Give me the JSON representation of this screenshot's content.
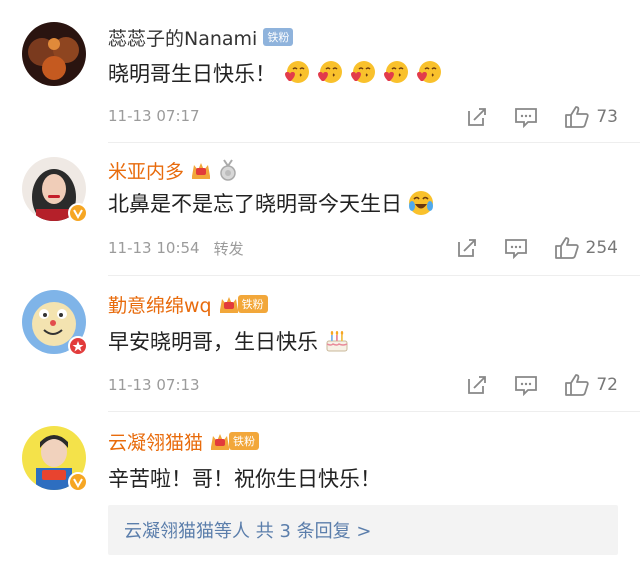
{
  "comments": [
    {
      "username": "蕊蕊子的Nanami",
      "badge": "铁粉",
      "text": "晓明哥生日快乐！",
      "emoji_count": 5,
      "emoji_icon": "kiss-heart-emoji",
      "time": "11-13 07:17",
      "likes": "73"
    },
    {
      "username": "米亚内多",
      "text": "北鼻是不是忘了晓明哥今天生日",
      "emoji_icon": "crying-laughing-emoji",
      "time": "11-13 10:54",
      "forward": "转发",
      "likes": "254"
    },
    {
      "username": "勤意绵绵wq",
      "badge": "铁粉",
      "text": "早安晓明哥，生日快乐",
      "emoji_icon": "birthday-cake-emoji",
      "time": "11-13 07:13",
      "likes": "72"
    },
    {
      "username": "云凝翎猫猫",
      "badge": "铁粉",
      "text": "辛苦啦！哥！祝你生日快乐！"
    }
  ],
  "replies_link": "云凝翎猫猫等人  共 3 条回复 >",
  "colors": {
    "gold_name": "#e86b0c",
    "link": "#5b7eab",
    "badge_blue": "#8fb3dc",
    "badge_orange": "#f2a73a"
  }
}
